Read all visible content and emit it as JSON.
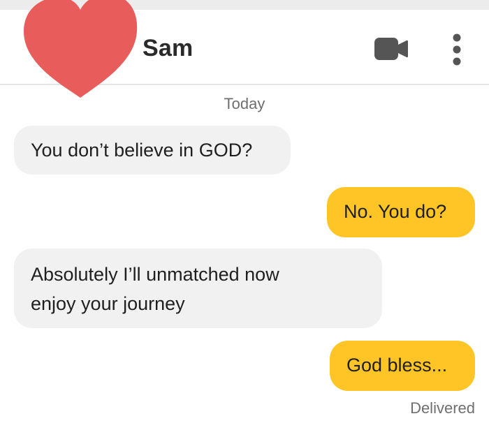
{
  "header": {
    "contact_name": "Sam",
    "avatar_color": "#e85c5c",
    "video_icon": "video-camera-icon",
    "more_icon": "more-vertical-icon"
  },
  "conversation": {
    "date_separator": "Today",
    "messages": [
      {
        "direction": "incoming",
        "lines": [
          "You don’t believe in GOD?"
        ]
      },
      {
        "direction": "outgoing",
        "lines": [
          "No. You do?"
        ]
      },
      {
        "direction": "incoming",
        "lines": [
          "Absolutely I’ll unmatched now",
          "enjoy your journey"
        ]
      },
      {
        "direction": "outgoing",
        "lines": [
          "God bless..."
        ]
      }
    ],
    "status": "Delivered"
  },
  "colors": {
    "incoming_bubble": "#f1f1f1",
    "outgoing_bubble": "#ffc426",
    "header_icons": "#555555"
  }
}
